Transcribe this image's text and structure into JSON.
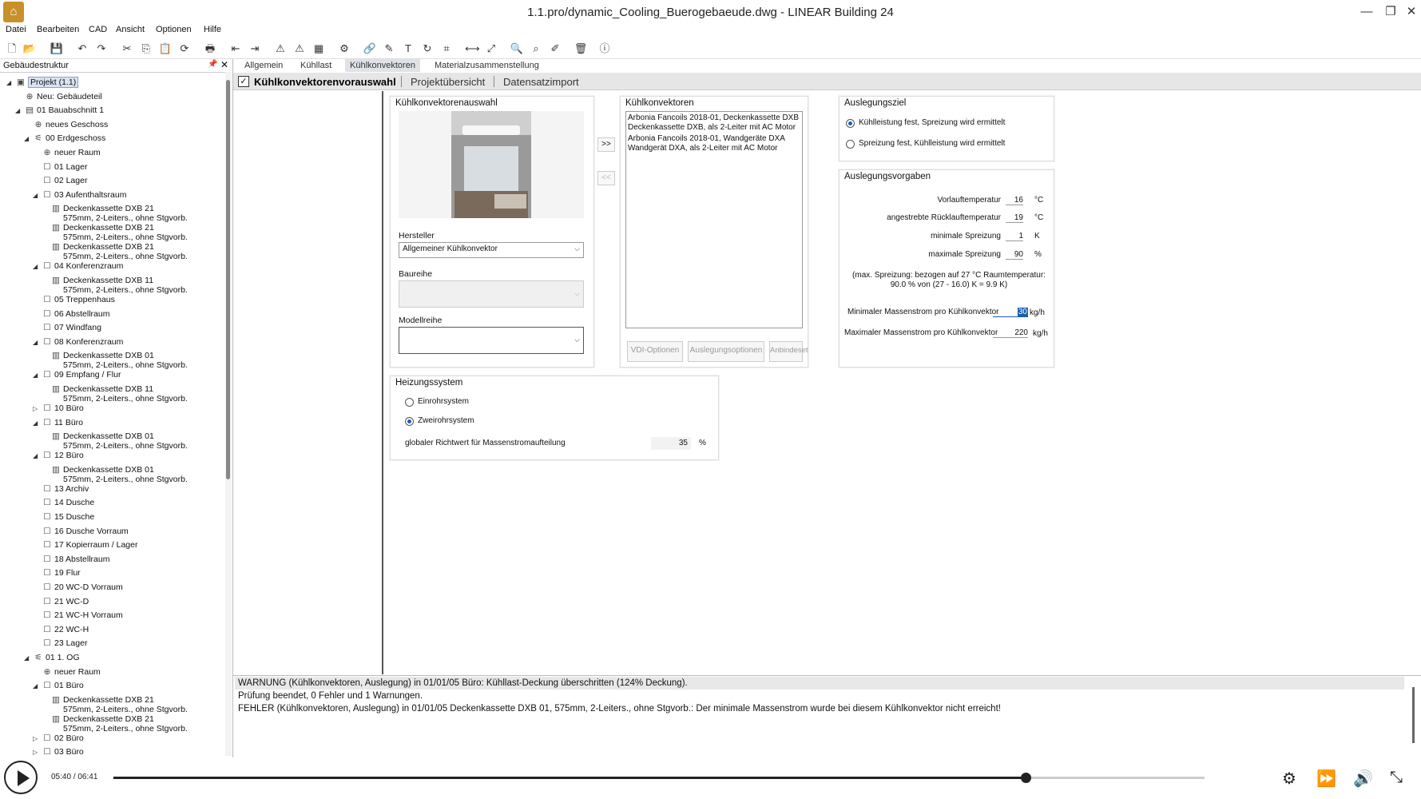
{
  "window": {
    "title": "1.1.pro/dynamic_Cooling_Buerogebaeude.dwg - LINEAR Building 24",
    "app_icon": "linear-app-icon"
  },
  "menu": [
    "Datei",
    "Bearbeiten",
    "CAD",
    "Ansicht",
    "Optionen",
    "Hilfe"
  ],
  "left_panel": {
    "title": "Gebäudestruktur",
    "tree": [
      {
        "d": 0,
        "t": "Projekt (1.1)",
        "i": "project",
        "tw": "open",
        "sel": true
      },
      {
        "d": 1,
        "t": "Neu: Gebäudeteil",
        "i": "plus"
      },
      {
        "d": 1,
        "t": "01 Bauabschnitt 1",
        "i": "section",
        "tw": "open"
      },
      {
        "d": 2,
        "t": "neues Geschoss",
        "i": "plus"
      },
      {
        "d": 2,
        "t": "00 Erdgeschoss",
        "i": "floor",
        "tw": "open"
      },
      {
        "d": 3,
        "t": "neuer Raum",
        "i": "plus"
      },
      {
        "d": 3,
        "t": "01 Lager",
        "i": "room"
      },
      {
        "d": 3,
        "t": "02 Lager",
        "i": "room"
      },
      {
        "d": 3,
        "t": "03 Aufenthaltsraum",
        "i": "room",
        "tw": "open"
      },
      {
        "d": 4,
        "t": "Deckenkassette DXB 21",
        "t2": "575mm, 2-Leiters., ohne Stgvorb.",
        "i": "unit"
      },
      {
        "d": 4,
        "t": "Deckenkassette DXB 21",
        "t2": "575mm, 2-Leiters., ohne Stgvorb.",
        "i": "unit"
      },
      {
        "d": 4,
        "t": "Deckenkassette DXB 21",
        "t2": "575mm, 2-Leiters., ohne Stgvorb.",
        "i": "unit"
      },
      {
        "d": 3,
        "t": "04 Konferenzraum",
        "i": "room",
        "tw": "open"
      },
      {
        "d": 4,
        "t": "Deckenkassette DXB 11",
        "t2": "575mm, 2-Leiters., ohne Stgvorb.",
        "i": "unit"
      },
      {
        "d": 3,
        "t": "05 Treppenhaus",
        "i": "room"
      },
      {
        "d": 3,
        "t": "06 Abstellraum",
        "i": "room"
      },
      {
        "d": 3,
        "t": "07 Windfang",
        "i": "room"
      },
      {
        "d": 3,
        "t": "08 Konferenzraum",
        "i": "room",
        "tw": "open"
      },
      {
        "d": 4,
        "t": "Deckenkassette DXB 01",
        "t2": "575mm, 2-Leiters., ohne Stgvorb.",
        "i": "unit"
      },
      {
        "d": 3,
        "t": "09 Empfang / Flur",
        "i": "room",
        "tw": "open"
      },
      {
        "d": 4,
        "t": "Deckenkassette DXB 11",
        "t2": "575mm, 2-Leiters., ohne Stgvorb.",
        "i": "unit"
      },
      {
        "d": 3,
        "t": "10 Büro",
        "i": "room",
        "tw": "closed"
      },
      {
        "d": 3,
        "t": "11 Büro",
        "i": "room",
        "tw": "open"
      },
      {
        "d": 4,
        "t": "Deckenkassette DXB 01",
        "t2": "575mm, 2-Leiters., ohne Stgvorb.",
        "i": "unit"
      },
      {
        "d": 3,
        "t": "12 Büro",
        "i": "room",
        "tw": "open"
      },
      {
        "d": 4,
        "t": "Deckenkassette DXB 01",
        "t2": "575mm, 2-Leiters., ohne Stgvorb.",
        "i": "unit"
      },
      {
        "d": 3,
        "t": "13 Archiv",
        "i": "room"
      },
      {
        "d": 3,
        "t": "14 Dusche",
        "i": "room"
      },
      {
        "d": 3,
        "t": "15 Dusche",
        "i": "room"
      },
      {
        "d": 3,
        "t": "16 Dusche Vorraum",
        "i": "room"
      },
      {
        "d": 3,
        "t": "17 Kopierraum / Lager",
        "i": "room"
      },
      {
        "d": 3,
        "t": "18 Abstellraum",
        "i": "room"
      },
      {
        "d": 3,
        "t": "19 Flur",
        "i": "room"
      },
      {
        "d": 3,
        "t": "20 WC-D Vorraum",
        "i": "room"
      },
      {
        "d": 3,
        "t": "21 WC-D",
        "i": "room"
      },
      {
        "d": 3,
        "t": "21 WC-H Vorraum",
        "i": "room"
      },
      {
        "d": 3,
        "t": "22 WC-H",
        "i": "room"
      },
      {
        "d": 3,
        "t": "23 Lager",
        "i": "room"
      },
      {
        "d": 2,
        "t": "01 1. OG",
        "i": "floor",
        "tw": "open"
      },
      {
        "d": 3,
        "t": "neuer Raum",
        "i": "plus"
      },
      {
        "d": 3,
        "t": "01 Büro",
        "i": "room",
        "tw": "open"
      },
      {
        "d": 4,
        "t": "Deckenkassette DXB 21",
        "t2": "575mm, 2-Leiters., ohne Stgvorb.",
        "i": "unit"
      },
      {
        "d": 4,
        "t": "Deckenkassette DXB 21",
        "t2": "575mm, 2-Leiters., ohne Stgvorb.",
        "i": "unit"
      },
      {
        "d": 3,
        "t": "02 Büro",
        "i": "room",
        "tw": "closed"
      },
      {
        "d": 3,
        "t": "03 Büro",
        "i": "room",
        "tw": "closed"
      }
    ]
  },
  "tabs": [
    "Allgemein",
    "Kühllast",
    "Kühlkonvektoren",
    "Materialzusammenstellung"
  ],
  "subtabs": [
    "Kühlkonvektorenvorauswahl",
    "Projektübersicht",
    "Datensatzimport"
  ],
  "selection": {
    "title": "Kühlkonvektorenauswahl",
    "hersteller_label": "Hersteller",
    "hersteller_value": "Allgemeiner Kühlkonvektor",
    "baureihe_label": "Baureihe",
    "baureihe_value": "",
    "modellreihe_label": "Modellreihe",
    "modellreihe_value": ""
  },
  "transfer": {
    "add": ">>",
    "remove": "<<"
  },
  "convectors": {
    "title": "Kühlkonvektoren",
    "items": [
      {
        "l1": "Arbonia Fancoils 2018-01, Deckenkassette DXB",
        "l2": "Deckenkassette DXB, als 2-Leiter mit AC Motor"
      },
      {
        "l1": "Arbonia Fancoils 2018-01, Wandgeräte DXA",
        "l2": "Wandgerät DXA, als 2-Leiter mit AC Motor"
      }
    ],
    "buttons": [
      "VDI-Optionen",
      "Auslegungsoptionen",
      "Anbindeset"
    ]
  },
  "ziel": {
    "title": "Auslegungsziel",
    "options": [
      "Kühlleistung fest, Spreizung wird ermittelt",
      "Spreizung fest, Kühlleistung wird ermittelt"
    ],
    "selected": 0
  },
  "vorgaben": {
    "title": "Auslegungsvorgaben",
    "rows": [
      {
        "label": "Vorlauftemperatur",
        "value": "16",
        "unit": "°C"
      },
      {
        "label": "angestrebte Rücklauftemperatur",
        "value": "19",
        "unit": "°C"
      },
      {
        "label": "minimale Spreizung",
        "value": "1",
        "unit": "K"
      },
      {
        "label": "maximale Spreizung",
        "value": "90",
        "unit": "%"
      }
    ],
    "note1": "(max. Spreizung: bezogen auf 27 °C Raumtemperatur:",
    "note2": "90.0 % von (27 - 16.0) K = 9.9 K)",
    "min_label": "Minimaler Massenstrom pro Kühlkonvektor",
    "min_value": "30",
    "min_unit": "kg/h",
    "max_label": "Maximaler Massenstrom pro Kühlkonvektor",
    "max_value": "220",
    "max_unit": "kg/h"
  },
  "heizung": {
    "title": "Heizungssystem",
    "options": [
      "Einrohrsystem",
      "Zweirohrsystem"
    ],
    "selected": 1,
    "richtwert_label": "globaler Richtwert für Massenstromaufteilung",
    "richtwert_value": "35",
    "richtwert_unit": "%"
  },
  "log": [
    "WARNUNG (Kühlkonvektoren, Auslegung) in 01/01/05 Büro: Kühllast-Deckung überschritten (124% Deckung).",
    "Prüfung beendet, 0 Fehler und 1 Warnungen.",
    "FEHLER (Kühlkonvektoren, Auslegung) in 01/01/05 Deckenkassette DXB 01, 575mm, 2-Leiters., ohne Stgvorb.: Der minimale Massenstrom wurde bei diesem Kühlkonvektor nicht erreicht!"
  ],
  "video": {
    "time": "05:40 / 06:41",
    "progress": 0.836
  },
  "colors": {
    "accent": "#1a5fb4",
    "tab_active": "#dfe3e8",
    "log_highlight": "#e8e8e8"
  }
}
